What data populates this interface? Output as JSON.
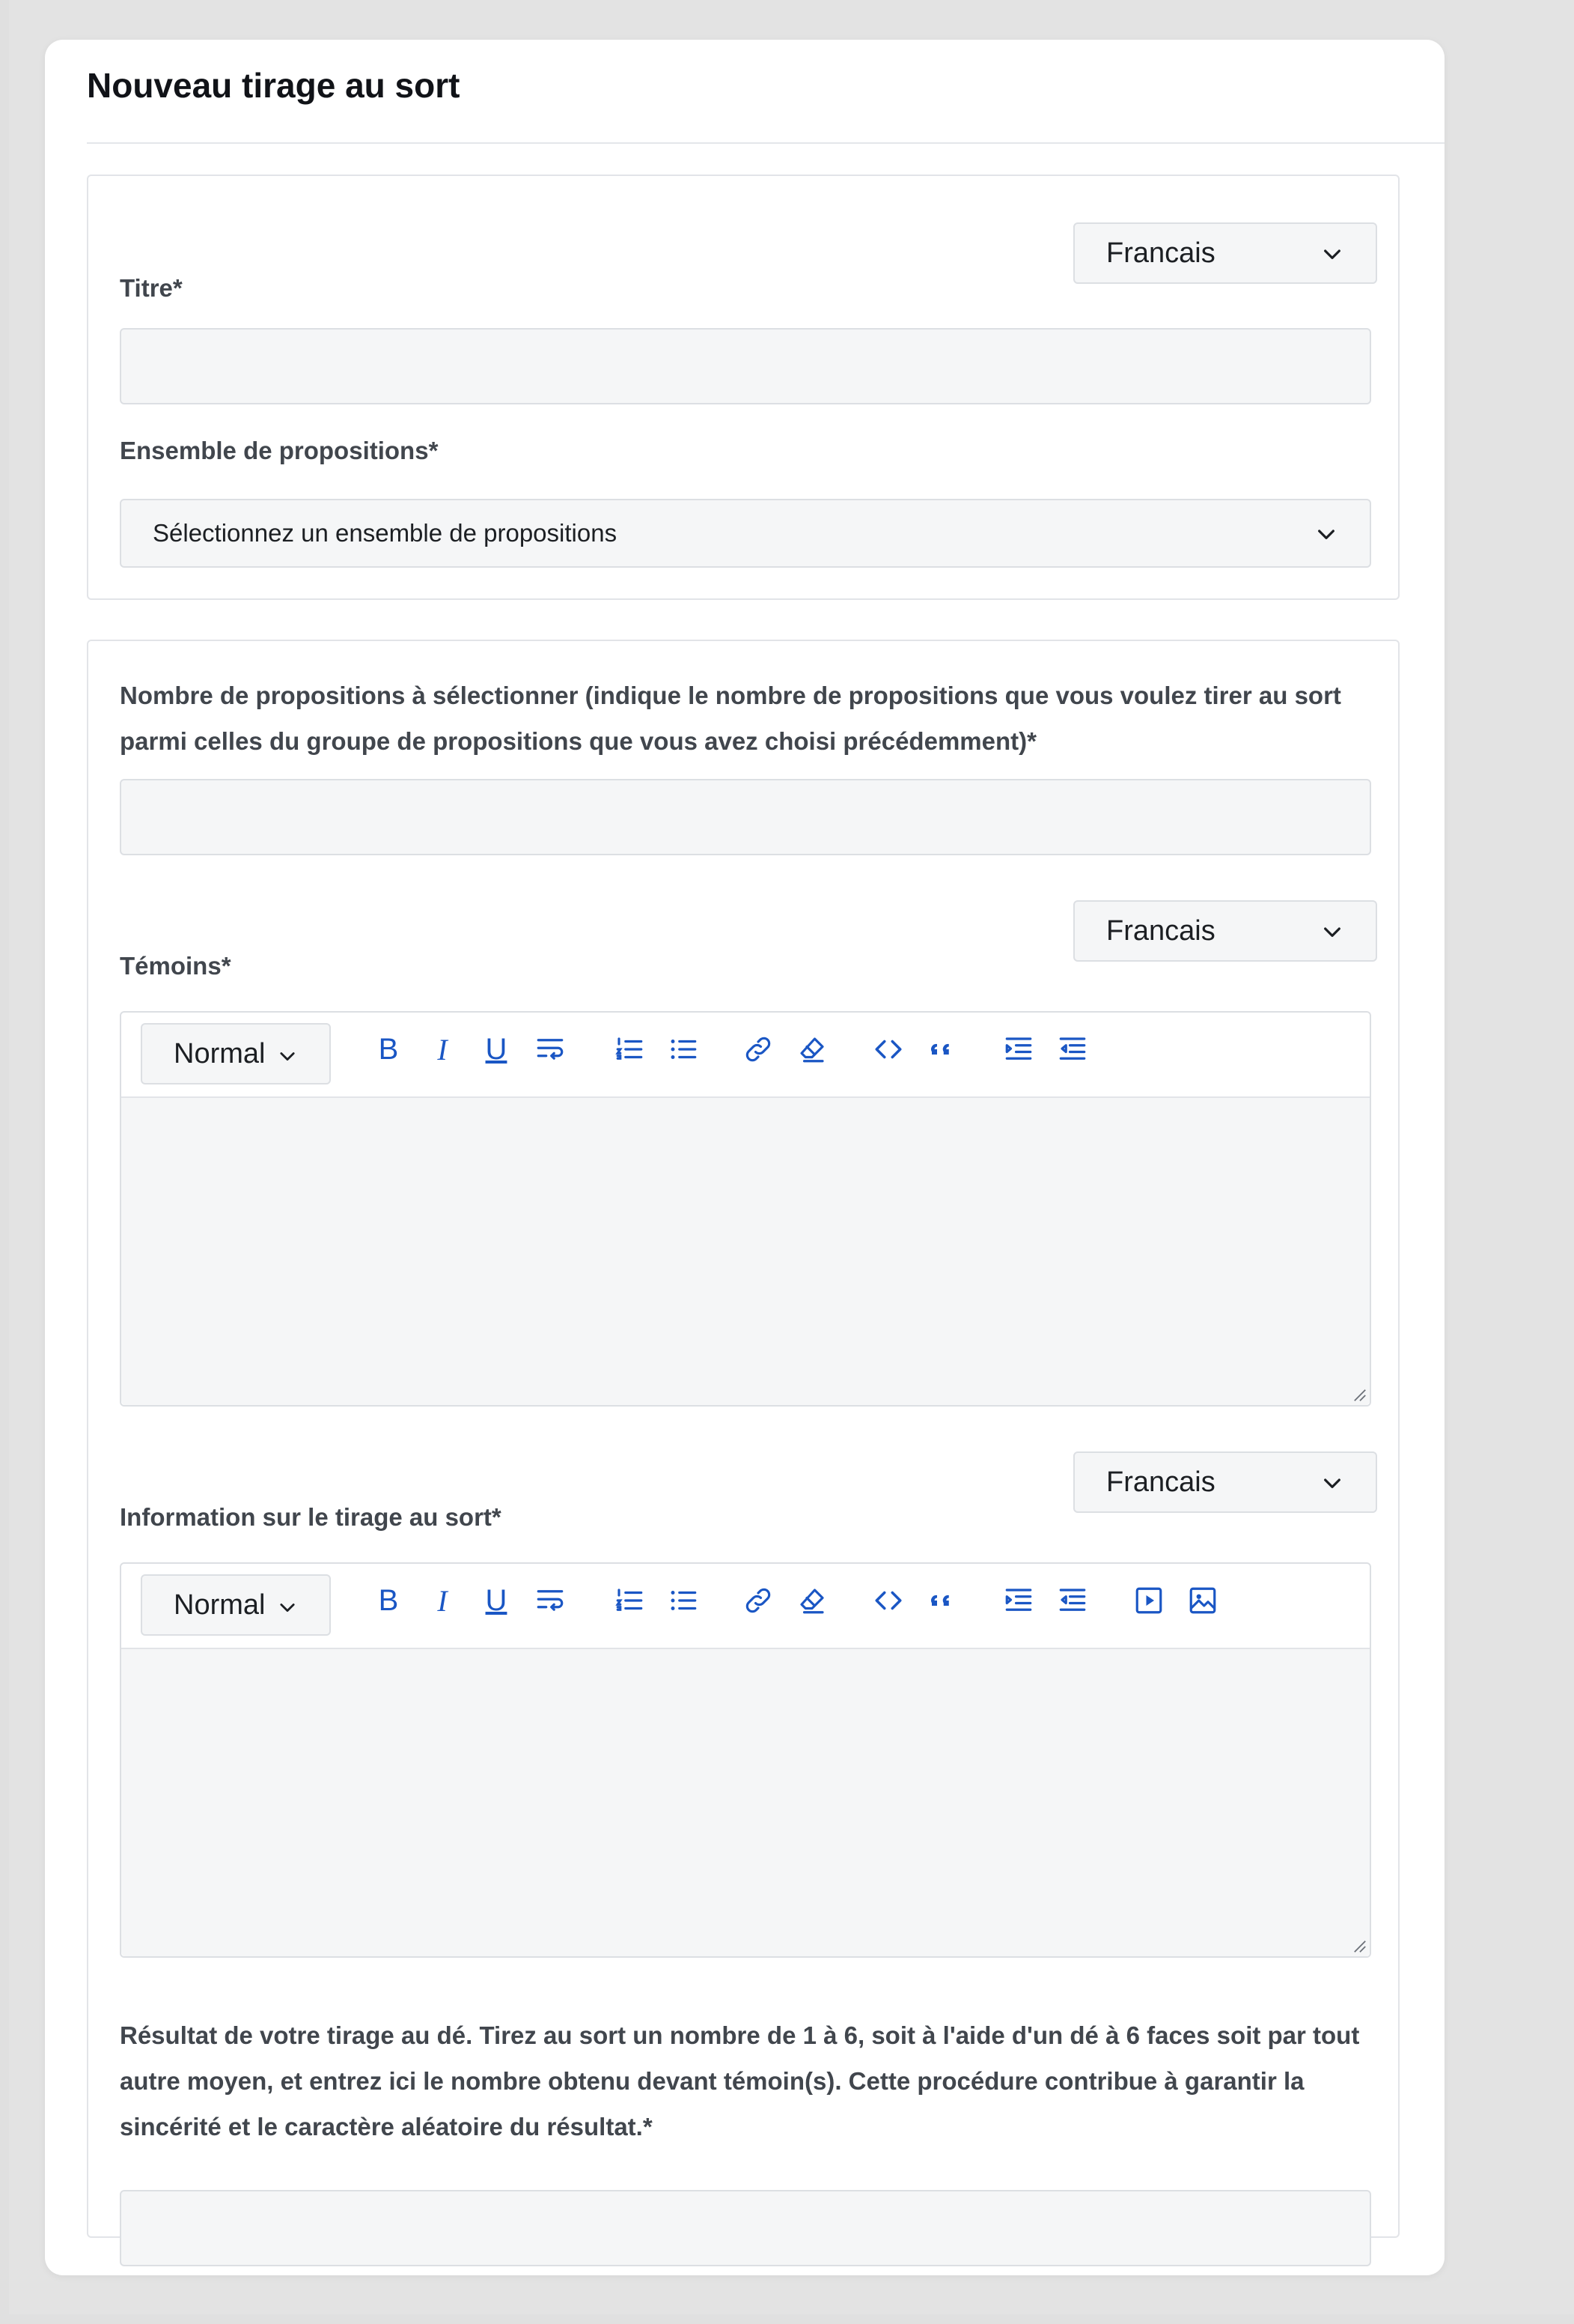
{
  "page": {
    "title": "Nouveau tirage au sort"
  },
  "section1": {
    "language_select": {
      "value": "Francais"
    },
    "title_field": {
      "label": "Titre*",
      "value": ""
    },
    "proposal_set": {
      "label": "Ensemble de propositions*",
      "value": "Sélectionnez un ensemble de propositions"
    }
  },
  "section2": {
    "count_field": {
      "label_line1": "Nombre de propositions à sélectionner (indique le nombre de propositions que vous voulez tirer au sort",
      "label_line2": "parmi celles du groupe de propositions que vous avez choisi précédemment)*",
      "value": ""
    },
    "witnesses": {
      "language": "Francais",
      "label": "Témoins*",
      "format": "Normal",
      "content": ""
    },
    "draw_info": {
      "language": "Francais",
      "label": "Information sur le tirage au sort*",
      "format": "Normal",
      "content": ""
    },
    "dice_result": {
      "label_line1": "Résultat de votre tirage au dé. Tirez au sort un nombre de 1 à 6, soit à l'aide d'un dé à 6 faces soit par tout",
      "label_line2": "autre moyen, et entrez ici le nombre obtenu devant témoin(s). Cette procédure contribue à garantir la",
      "label_line3": "sincérité et le caractère aléatoire du résultat.*",
      "value": ""
    }
  },
  "toolbar": {
    "bold_glyph": "B",
    "italic_glyph": "I",
    "underline_glyph": "U",
    "code_glyph": "<>",
    "quote_glyph": "66"
  },
  "colors": {
    "accent": "#1a56c4",
    "field_bg": "#f5f6f7",
    "border": "#dcdfe3"
  },
  "icons": [
    "chevron-down-icon",
    "bold-icon",
    "italic-icon",
    "underline-icon",
    "wrap-text-icon",
    "ordered-list-icon",
    "bullet-list-icon",
    "link-icon",
    "clear-format-icon",
    "code-icon",
    "blockquote-icon",
    "indent-icon",
    "outdent-icon",
    "video-icon",
    "image-icon"
  ]
}
